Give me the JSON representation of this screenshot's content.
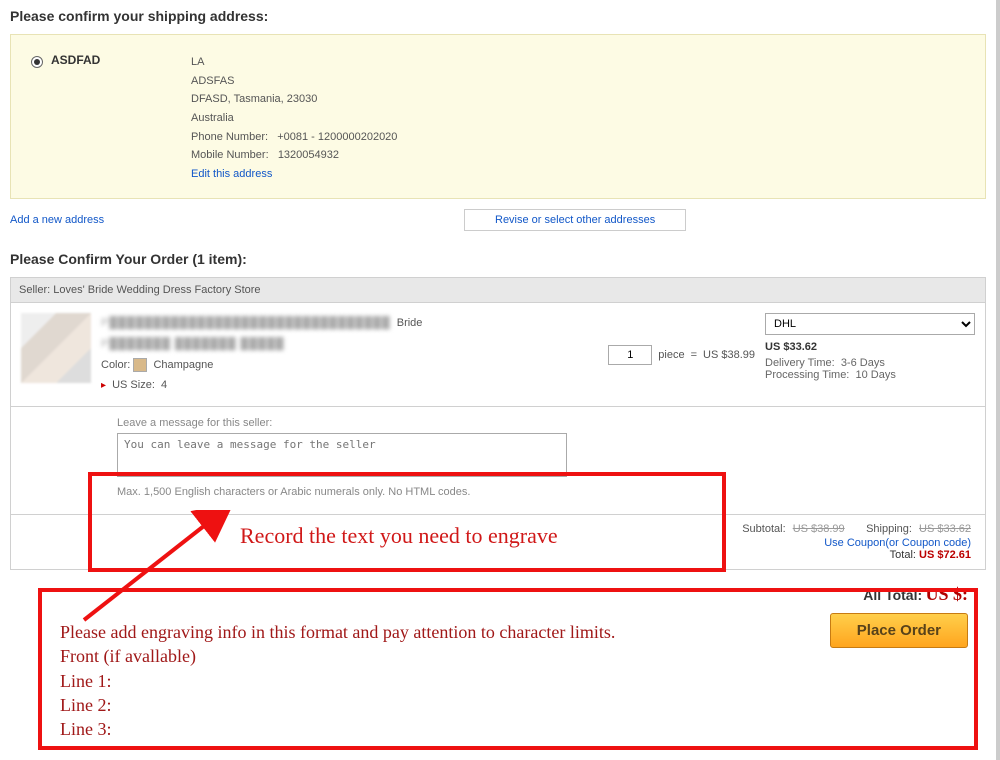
{
  "shipping": {
    "title": "Please confirm your shipping address:",
    "name": "ASDFAD",
    "line1": "LA",
    "line2": "ADSFAS",
    "line3": "DFASD, Tasmania, 23030",
    "country": "Australia",
    "phone_label": "Phone Number:",
    "phone": "+0081 - 1200000202020",
    "mobile_label": "Mobile Number:",
    "mobile": "1320054932",
    "edit_link": "Edit this address",
    "add_link": "Add a new address",
    "revise_link": "Revise or select other addresses"
  },
  "order": {
    "title": "Please Confirm Your Order (1 item):",
    "seller_label": "Seller: Loves' Bride Wedding Dress Factory Store",
    "prod_title_blur": "P████████████████████████████████",
    "prod_suffix": "Bride",
    "prod_sub_blur": "P███████ ███████ █████",
    "color_label": "Color:",
    "color_value": "Champagne",
    "size_label": "US Size:",
    "size_value": "4",
    "qty_value": "1",
    "qty_unit": "piece",
    "qty_equals": "=",
    "unit_price": "US $38.99",
    "ship_option": "DHL",
    "ship_price": "US $33.62",
    "delivery_label": "Delivery Time:",
    "delivery_value": "3-6 Days",
    "processing_label": "Processing Time:",
    "processing_value": "10 Days",
    "msg_label": "Leave a message for this seller:",
    "msg_placeholder": "You can leave a message for the seller",
    "msg_hint": "Max. 1,500 English characters or Arabic numerals only. No HTML codes.",
    "subtotal_label": "Subtotal:",
    "subtotal_value": "US $38.99",
    "shipping_label": "Shipping:",
    "shipping_value": "US $33.62",
    "coupon_link": "Use Coupon(or Coupon code)",
    "total_label": "Total:",
    "total_value": "US $72.61",
    "all_total_label": "All Total:",
    "all_total_value": "US $:",
    "place_order": "Place Order"
  },
  "annotations": {
    "record_text": "Record the text you need to engrave",
    "instr1": "Please add engraving info in this format and pay attention to character limits.",
    "instr2": "Front (if avallable)",
    "instr3": "Line 1:",
    "instr4": "Line 2:",
    "instr5": "Line 3:"
  }
}
